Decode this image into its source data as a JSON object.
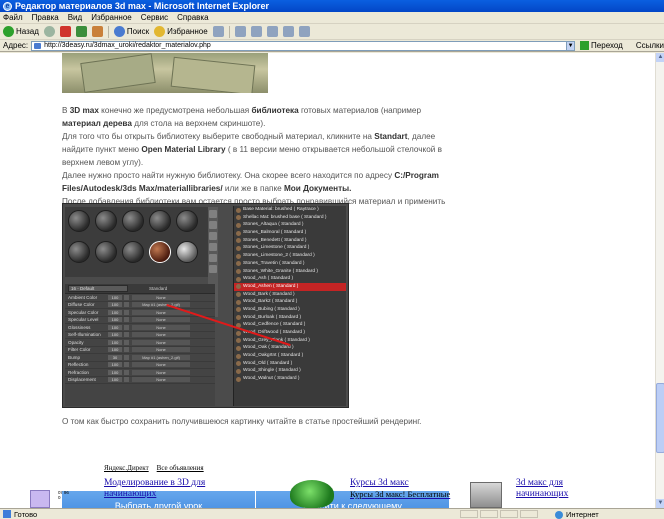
{
  "window": {
    "title": "Редактор материалов 3d max - Microsoft Internet Explorer"
  },
  "menu": [
    "Файл",
    "Правка",
    "Вид",
    "Избранное",
    "Сервис",
    "Справка"
  ],
  "toolbar": {
    "back": "Назад",
    "search": "Поиск",
    "favorites": "Избранное"
  },
  "address": {
    "label": "Адрес:",
    "url": "http://3deasy.ru/3dmax_uroki/redaktor_materialov.php",
    "go": "Переход",
    "links": "Ссылки"
  },
  "article": {
    "p1_a": "В ",
    "p1_b": "3D max",
    "p1_c": " конечно же предусмотрена небольшая ",
    "p1_d": "библиотека",
    "p1_e": " готовых материалов (например ",
    "p1_f": "материал дерева",
    "p1_g": " для стола на верхнем скриншоте).",
    "p2_a": "Для того что бы открыть библиотеку выберите свободный материал, кликните на ",
    "p2_b": "Standart",
    "p2_c": ", далее найдите пункт меню ",
    "p2_d": "Open Material Library",
    "p2_e": " ( в 11 версии меню открывается небольшой стелочкой в верхнем левом углу).",
    "p3_a": "Далее нужно просто найти нужную библиотеку. Она скорее всего находится по адресу ",
    "p3_b": "C:/Program Files/Autodesk/3ds Max/materiallibraries/",
    "p3_c": " или же в папке ",
    "p3_d": "Мои Документы.",
    "p4": "После добавления библиотеки вам остается просто выбрать понравившийся материал и применить его к объекту.",
    "caption": "О том как быстро сохранить получившеюся картинку читайте в статье простейший рендеринг."
  },
  "max_ui": {
    "material_slot": "16 - Default",
    "type": "Standard",
    "params": [
      {
        "name": "Ambient Color",
        "value": "100",
        "map": "None"
      },
      {
        "name": "Diffuse Color",
        "value": "100",
        "map": "Map #1 (ashen_2.gif)"
      },
      {
        "name": "Specular Color",
        "value": "100",
        "map": "None"
      },
      {
        "name": "Specular Level",
        "value": "100",
        "map": "None"
      },
      {
        "name": "Glossiness",
        "value": "100",
        "map": "None"
      },
      {
        "name": "Self-Illumination",
        "value": "100",
        "map": "None"
      },
      {
        "name": "Opacity",
        "value": "100",
        "map": "None"
      },
      {
        "name": "Filter Color",
        "value": "100",
        "map": "None"
      },
      {
        "name": "Bump",
        "value": "30",
        "map": "Map #1 (ashen_2.gif)"
      },
      {
        "name": "Reflection",
        "value": "100",
        "map": "None"
      },
      {
        "name": "Refraction",
        "value": "100",
        "map": "None"
      },
      {
        "name": "Displacement",
        "value": "100",
        "map": "None"
      }
    ],
    "library": [
      "Base Material: brushed ( Raytrace )",
      "Shellac Mat: brushed base ( Standard )",
      "Stones_Altaqua ( Standard )",
      "Stones_Balmoral ( Standard )",
      "Stones_Benedett ( Standard )",
      "Stones_Limestone ( Standard )",
      "Stones_Limestone_2 ( Standard )",
      "Stones_Travetin ( Standard )",
      "Stones_White_Granite ( Standard )",
      "Wood_Ash ( Standard )",
      "Wood_Ashen ( Standard )",
      "Wood_Bark ( Standard )",
      "Wood_Bark2 ( Standard )",
      "Wood_Bubing ( Standard )",
      "Wood_Burloak ( Standard )",
      "Wood_Cedfence ( Standard )",
      "Wood_Driftwood ( Standard )",
      "Wood_Grey_Plank ( Standard )",
      "Wood_Oak ( Standard )",
      "Wood_Oakgrtnt ( Standard )",
      "Wood_Old ( Standard )",
      "Wood_Shingle ( Standard )",
      "Wood_Walnut ( Standard )"
    ],
    "selected_index": 10
  },
  "buttons": {
    "prev": "Выбрать другой урок",
    "next": "Перейти к следующему"
  },
  "ads": {
    "yandex": "Яндекс.Директ",
    "all": "Все объявления",
    "ad1_title": "Моделирование в 3D для начинающих",
    "ad2_title": "Курсы 3d макс",
    "ad2_sub": "Курсы 3d макс! Бесплатные",
    "ad3_title": "3d макс для начинающих",
    "thumb_text": "0т 96 0"
  },
  "status": {
    "text": "Готово",
    "zone": "Интернет"
  }
}
